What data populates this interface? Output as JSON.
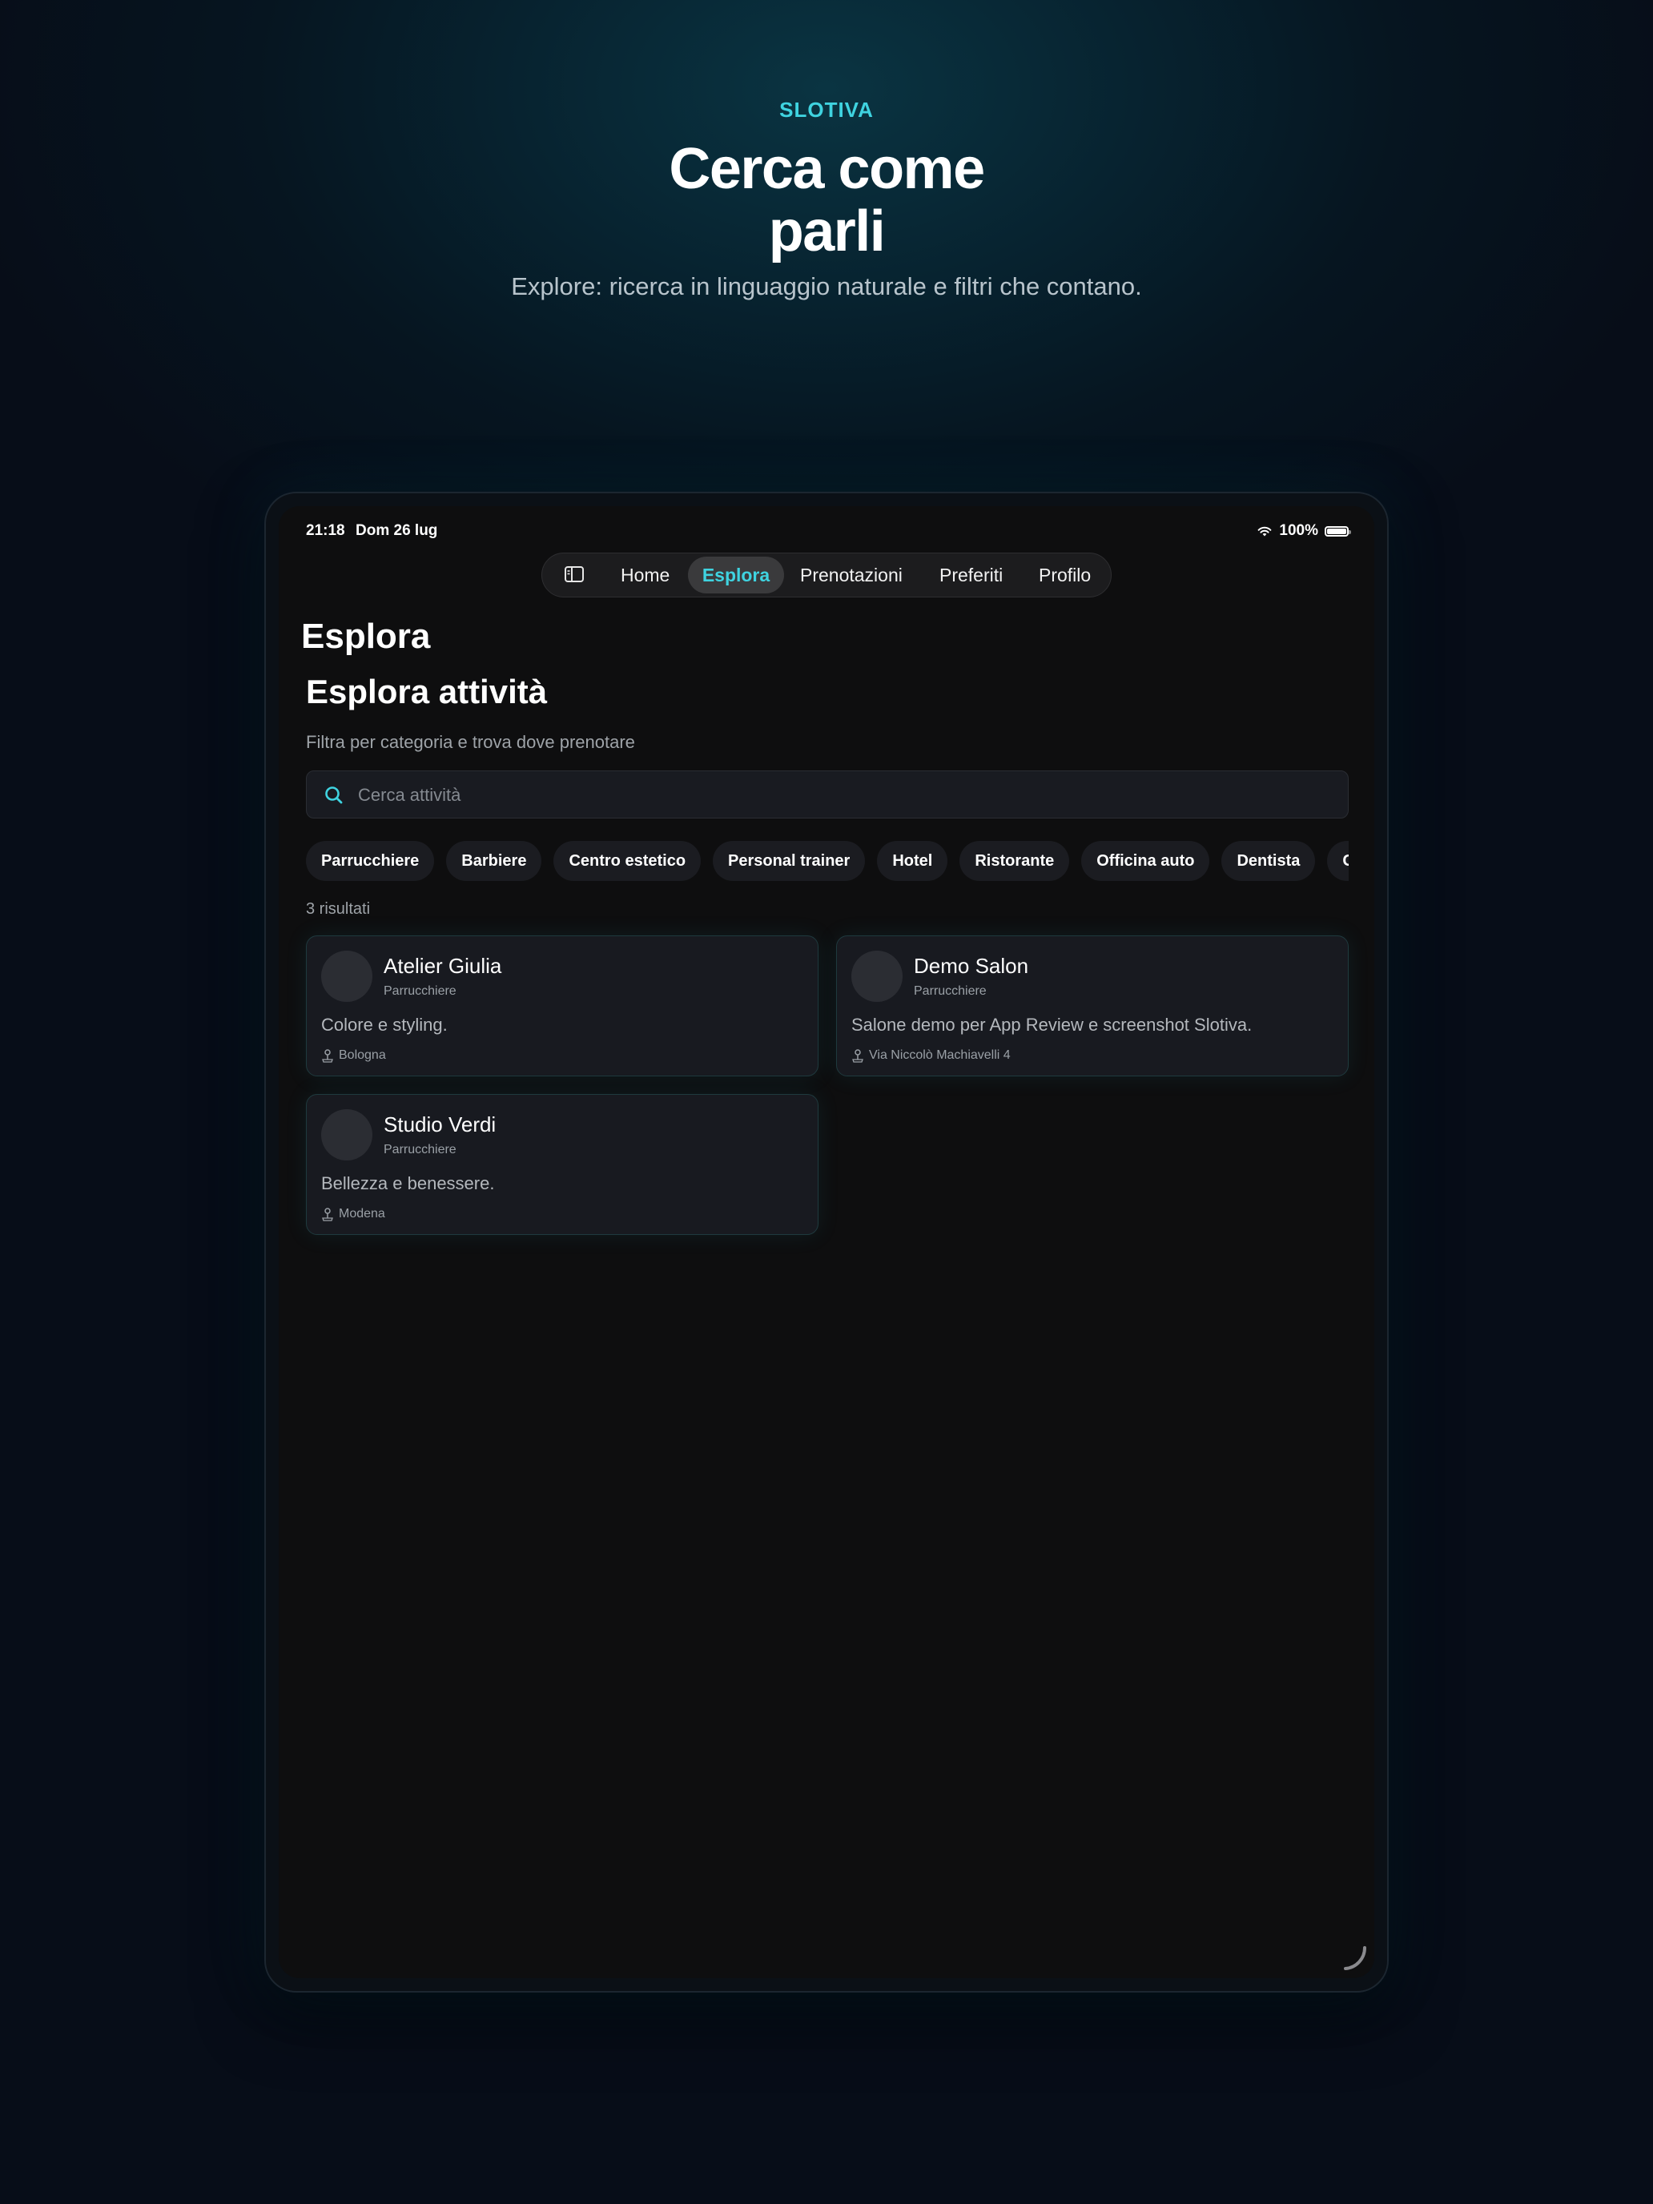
{
  "hero": {
    "brand": "SLOTIVA",
    "headline_line1": "Cerca come",
    "headline_line2": "parli",
    "subline": "Explore: ricerca in linguaggio naturale e filtri che contano."
  },
  "statusbar": {
    "time": "21:18",
    "date": "Dom 26 lug",
    "battery": "100%"
  },
  "nav": {
    "items": [
      "Home",
      "Esplora",
      "Prenotazioni",
      "Preferiti",
      "Profilo"
    ],
    "active": "Esplora"
  },
  "page": {
    "title": "Esplora",
    "section_title": "Esplora attività",
    "section_subtitle": "Filtra per categoria e trova dove prenotare"
  },
  "search": {
    "placeholder": "Cerca attività",
    "value": ""
  },
  "categories": [
    "Parrucchiere",
    "Barbiere",
    "Centro estetico",
    "Personal trainer",
    "Hotel",
    "Ristorante",
    "Officina auto",
    "Dentista",
    "C"
  ],
  "results": {
    "count_label": "3 risultati",
    "items": [
      {
        "name": "Atelier Giulia",
        "category": "Parrucchiere",
        "description": "Colore e styling.",
        "location": "Bologna"
      },
      {
        "name": "Demo Salon",
        "category": "Parrucchiere",
        "description": "Salone demo per App Review e screenshot Slotiva.",
        "location": "Via Niccolò Machiavelli 4"
      },
      {
        "name": "Studio Verdi",
        "category": "Parrucchiere",
        "description": "Bellezza e benessere.",
        "location": "Modena"
      }
    ]
  },
  "colors": {
    "accent": "#3fd3e0",
    "background": "#070d18",
    "screen": "#0e0e0f",
    "card": "#181a20"
  }
}
